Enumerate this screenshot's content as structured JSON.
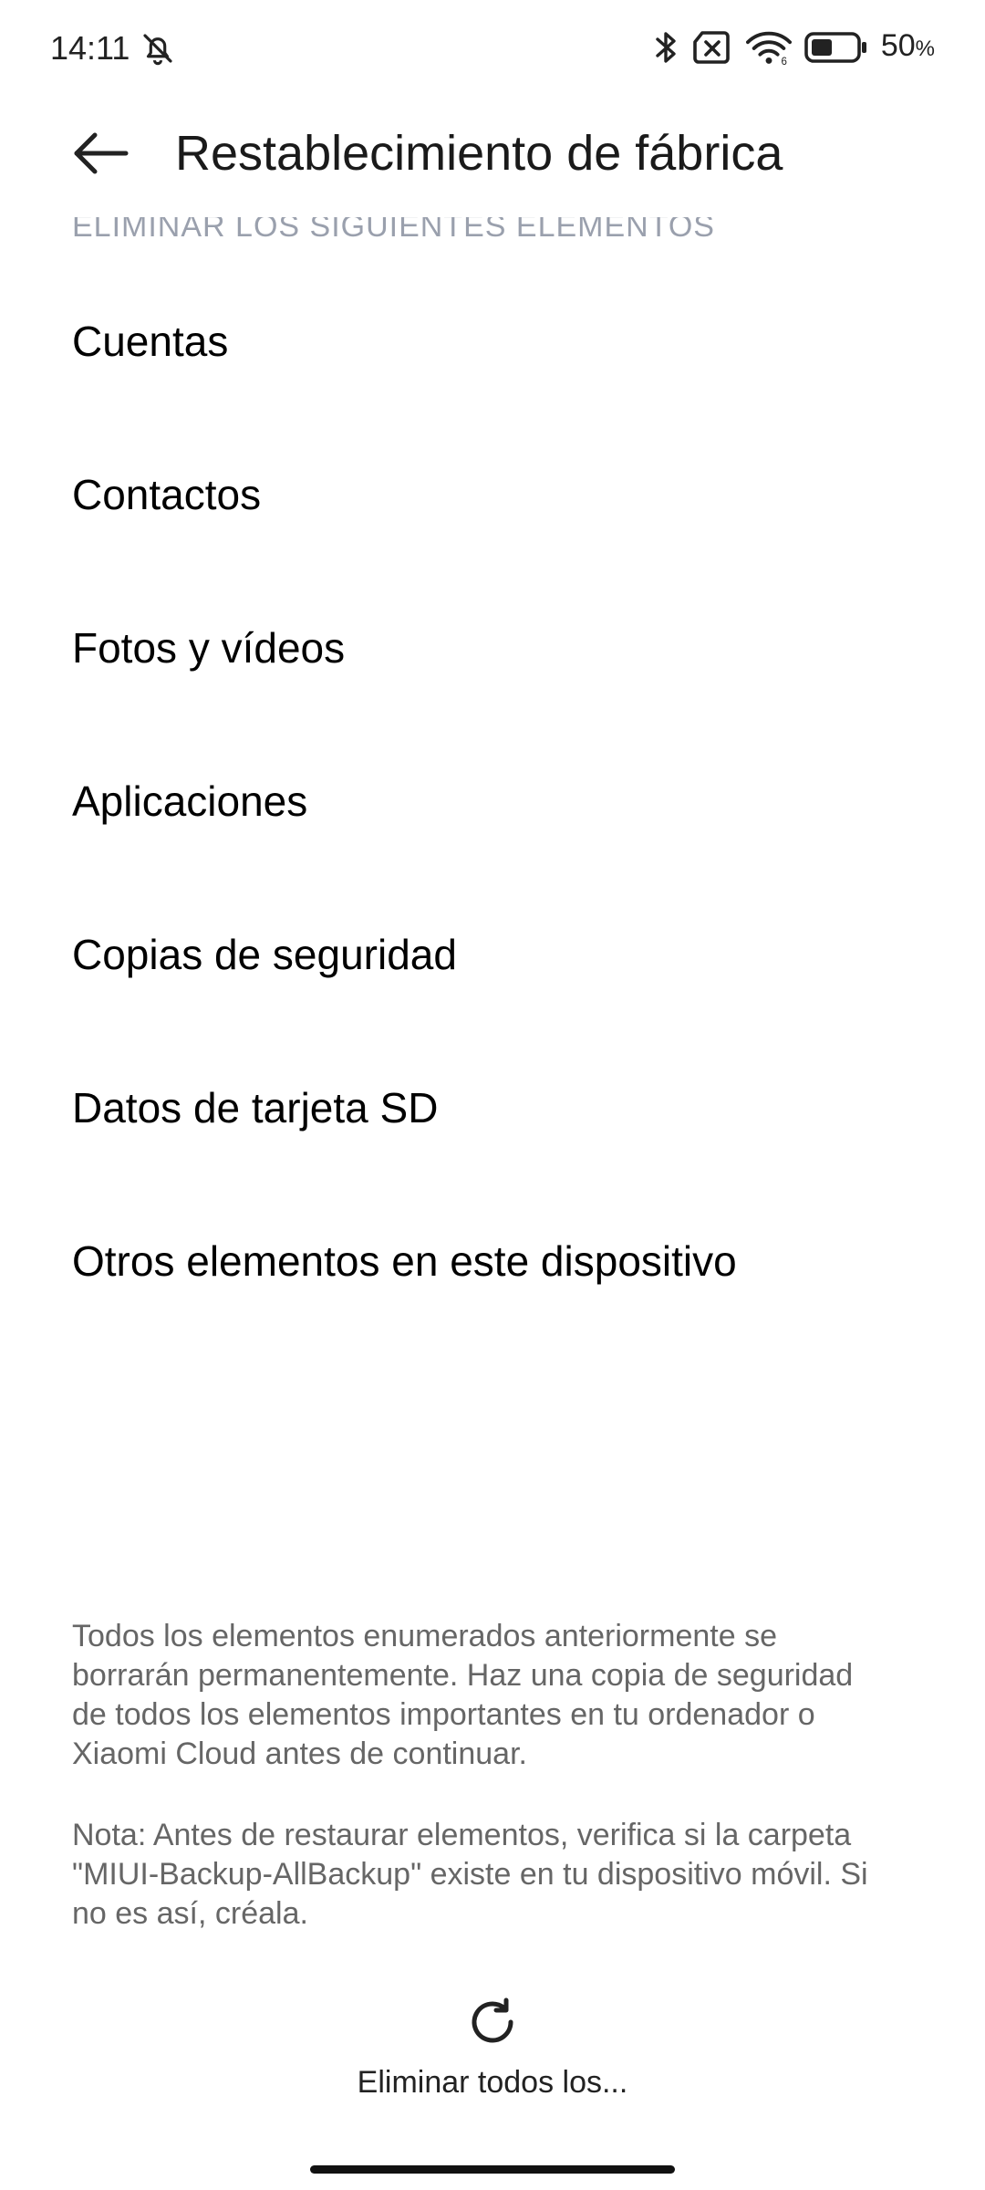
{
  "status_bar": {
    "time": "14:11",
    "battery_percent": "50",
    "battery_unit": "%",
    "icons": [
      "bell-off-icon",
      "bluetooth-icon",
      "no-sim-icon",
      "wifi-icon",
      "battery-icon"
    ]
  },
  "header": {
    "title": "Restablecimiento de fábrica",
    "back_icon": "arrow-left-icon"
  },
  "section": {
    "header": "ELIMINAR LOS SIGUIENTES ELEMENTOS",
    "items": [
      {
        "label": "Cuentas"
      },
      {
        "label": "Contactos"
      },
      {
        "label": "Fotos y vídeos"
      },
      {
        "label": "Aplicaciones"
      },
      {
        "label": "Copias de seguridad"
      },
      {
        "label": "Datos de tarjeta SD"
      },
      {
        "label": "Otros elementos en este dispositivo"
      }
    ]
  },
  "description": "Todos los elementos enumerados anteriormente se borrarán permanentemente. Haz una copia de seguridad de todos los elementos importantes en tu ordenador o Xiaomi Cloud antes de continuar.",
  "note": "Nota: Antes de restaurar elementos, verifica si la carpeta \"MIUI-Backup-AllBackup\" existe en tu dispositivo móvil. Si no es así, créala.",
  "action": {
    "icon": "reset-icon",
    "label": "Eliminar todos los..."
  },
  "colors": {
    "background": "#ffffff",
    "text_primary": "#000000",
    "text_secondary": "#666666",
    "section_header": "#9aa0ad"
  }
}
